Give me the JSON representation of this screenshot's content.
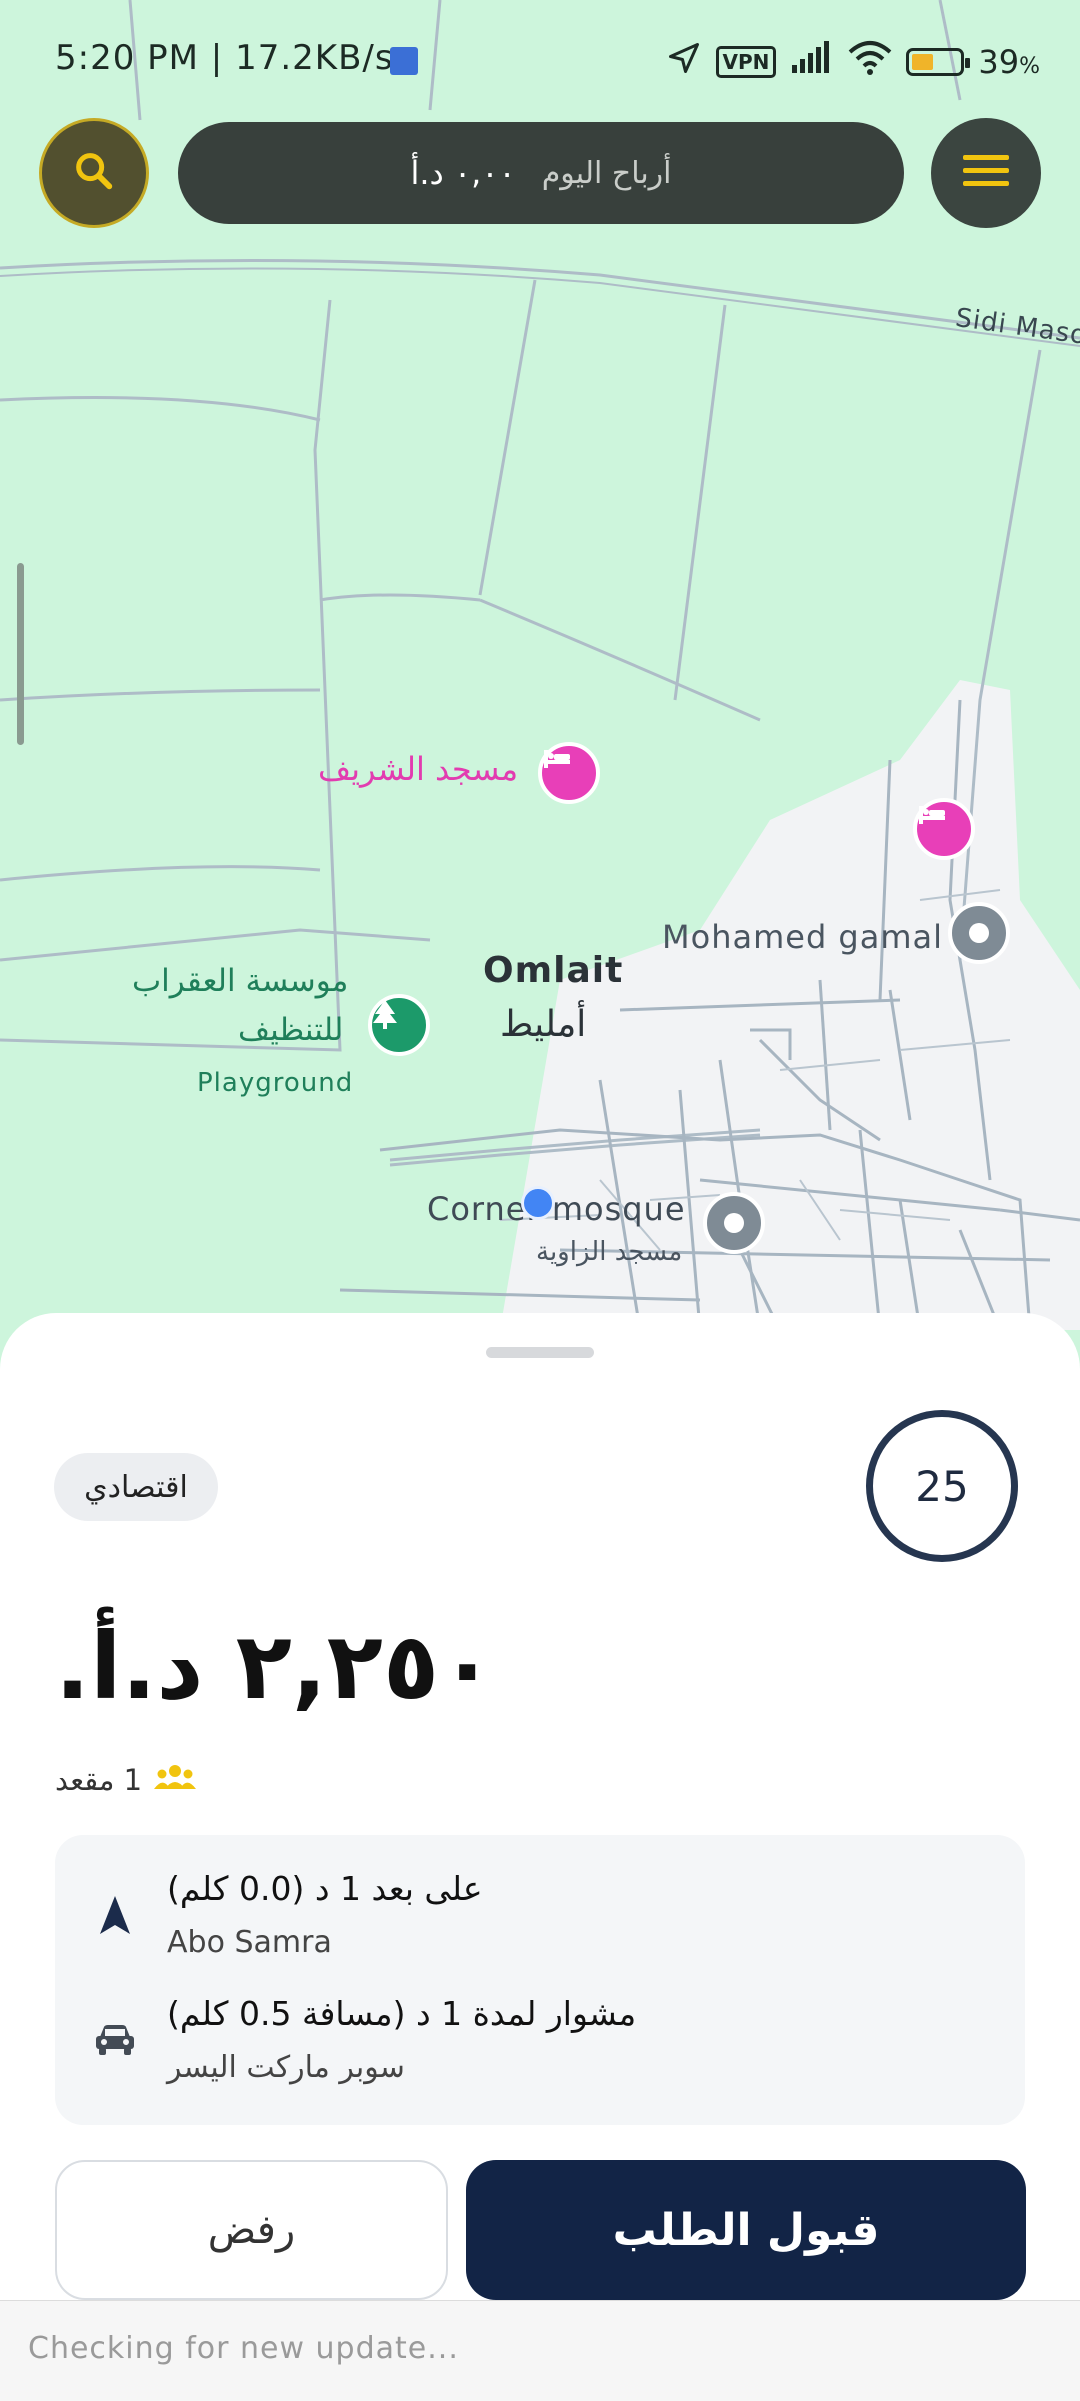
{
  "status_bar": {
    "time": "5:20 PM | 17.2KB/s",
    "vpn": "VPN",
    "battery": "39",
    "battery_unit": "%",
    "battery_level": 0.39,
    "icons": [
      "location-arrow-icon",
      "vpn-icon",
      "signal-icon",
      "wifi-icon",
      "battery-icon"
    ]
  },
  "topbar": {
    "search_icon": "search-icon",
    "menu_icon": "menu-icon",
    "earnings_label": "أرباح اليوم",
    "earnings_value": "٠,٠٠ د.أ"
  },
  "map": {
    "road_label": "Sidi Maso",
    "poi_mosque_sharif": "مسجد الشريف",
    "poi_mohamed_gamal": "Mohamed gamal",
    "town_en": "Omlait",
    "town_ar": "أمليط",
    "poi_aqrab_line1": "موسسة العقراب",
    "poi_aqrab_line2": "للتنظيف",
    "poi_playground": "Playground",
    "poi_corner_mosque": "Corner mosque",
    "poi_zawiya": "مسجد الزاوية",
    "colors": {
      "land": "#cdf5dc",
      "urban": "#f2f3f5",
      "road": "#9fb0bc",
      "poi_pink": "#e83fb8",
      "poi_green": "#1c9a6a",
      "poi_gray": "#7f8b95",
      "location_dot": "#4285f4"
    }
  },
  "ride_request": {
    "timer": "25",
    "category": "اقتصادي",
    "price": "٢,٢٥٠ د.أ.",
    "seats": "1 مقعد",
    "pickup": {
      "distance": "على بعد 1 د (0.0 كلم)",
      "place": "Abo Samra",
      "icon": "navigation-arrow-icon"
    },
    "dropoff": {
      "distance": "مشوار لمدة 1 د (مسافة 0.5 كلم)",
      "place": "سوبر ماركت اليسر",
      "icon": "car-icon"
    },
    "reject_label": "رفض",
    "accept_label": "قبول الطلب"
  },
  "update_bar": {
    "text": "Checking for new update..."
  }
}
